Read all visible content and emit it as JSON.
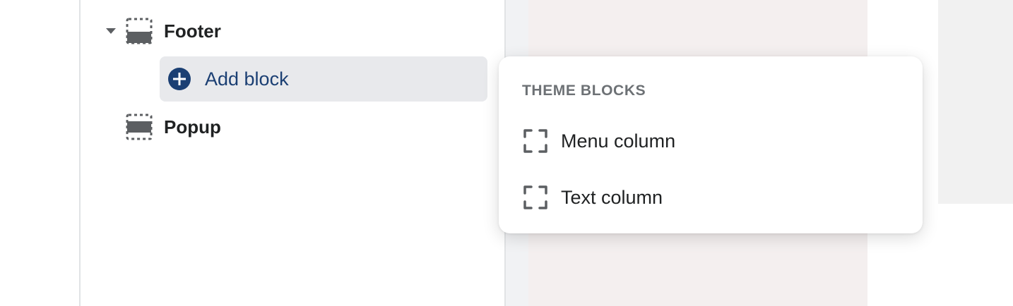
{
  "tree": {
    "sections": [
      {
        "label": "Footer",
        "icon": "footer-section-icon",
        "expanded": true
      },
      {
        "label": "Popup",
        "icon": "popup-section-icon",
        "expanded": false
      }
    ],
    "add_block": {
      "label": "Add block",
      "icon": "plus-circle-icon"
    }
  },
  "popover": {
    "heading": "THEME BLOCKS",
    "items": [
      {
        "label": "Menu column",
        "icon": "block-frame-icon"
      },
      {
        "label": "Text column",
        "icon": "block-frame-icon"
      }
    ]
  },
  "colors": {
    "accent": "#1b3f73",
    "text": "#202223",
    "muted": "#6d7175",
    "icon": "#5c5f62",
    "highlight_bg": "#e8e9ec",
    "preview_bg": "#f4efef"
  }
}
